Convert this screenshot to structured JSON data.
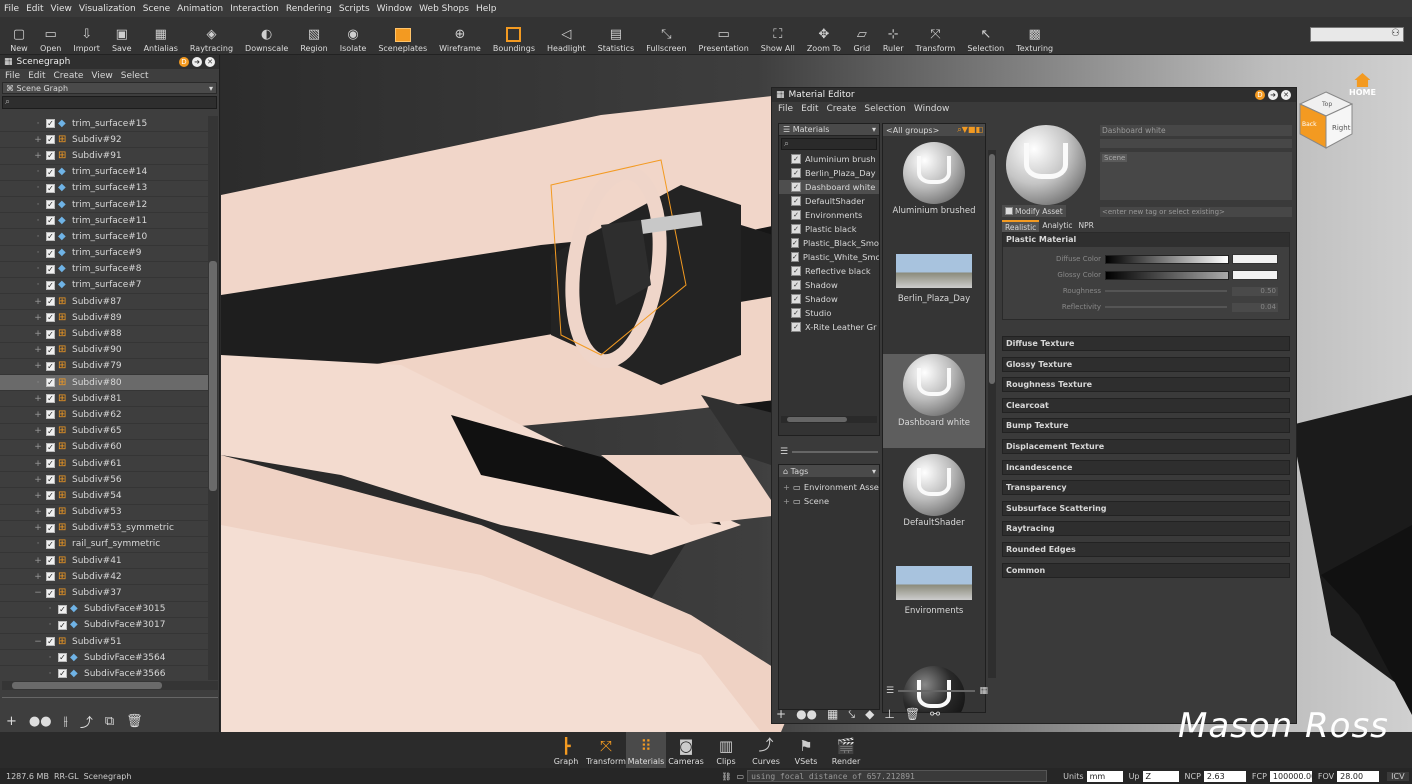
{
  "menubar": [
    "File",
    "Edit",
    "View",
    "Visualization",
    "Scene",
    "Animation",
    "Interaction",
    "Rendering",
    "Scripts",
    "Window",
    "Web Shops",
    "Help"
  ],
  "toolbar": [
    {
      "label": "New",
      "icon": "new-icon"
    },
    {
      "label": "Open",
      "icon": "open-icon"
    },
    {
      "label": "Import",
      "icon": "import-icon"
    },
    {
      "label": "Save",
      "icon": "save-icon"
    },
    {
      "label": "Antialias",
      "icon": "antialias-icon"
    },
    {
      "label": "Raytracing",
      "icon": "raytracing-icon"
    },
    {
      "label": "Downscale",
      "icon": "downscale-icon"
    },
    {
      "label": "Region",
      "icon": "region-icon"
    },
    {
      "label": "Isolate",
      "icon": "isolate-icon"
    },
    {
      "label": "Sceneplates",
      "icon": "sceneplates-icon"
    },
    {
      "label": "Wireframe",
      "icon": "wireframe-icon"
    },
    {
      "label": "Boundings",
      "icon": "boundings-icon"
    },
    {
      "label": "Headlight",
      "icon": "headlight-icon"
    },
    {
      "label": "Statistics",
      "icon": "statistics-icon"
    },
    {
      "label": "Fullscreen",
      "icon": "fullscreen-icon"
    },
    {
      "label": "Presentation",
      "icon": "presentation-icon"
    },
    {
      "label": "Show All",
      "icon": "show-all-icon"
    },
    {
      "label": "Zoom To",
      "icon": "zoom-to-icon"
    },
    {
      "label": "Grid",
      "icon": "grid-icon"
    },
    {
      "label": "Ruler",
      "icon": "ruler-icon"
    },
    {
      "label": "Transform",
      "icon": "transform-icon"
    },
    {
      "label": "Selection",
      "icon": "selection-icon"
    },
    {
      "label": "Texturing",
      "icon": "texturing-icon"
    }
  ],
  "scenegraph": {
    "title": "Scenegraph",
    "menu": [
      "File",
      "Edit",
      "Create",
      "View",
      "Select"
    ],
    "dropdown": "Scene Graph",
    "rows": [
      {
        "label": "trim_surface#15",
        "type": "trim",
        "exp": ""
      },
      {
        "label": "Subdiv#92",
        "type": "sub",
        "exp": "+"
      },
      {
        "label": "Subdiv#91",
        "type": "sub",
        "exp": "+"
      },
      {
        "label": "trim_surface#14",
        "type": "trim",
        "exp": ""
      },
      {
        "label": "trim_surface#13",
        "type": "trim",
        "exp": ""
      },
      {
        "label": "trim_surface#12",
        "type": "trim",
        "exp": ""
      },
      {
        "label": "trim_surface#11",
        "type": "trim",
        "exp": ""
      },
      {
        "label": "trim_surface#10",
        "type": "trim",
        "exp": ""
      },
      {
        "label": "trim_surface#9",
        "type": "trim",
        "exp": ""
      },
      {
        "label": "trim_surface#8",
        "type": "trim",
        "exp": ""
      },
      {
        "label": "trim_surface#7",
        "type": "trim",
        "exp": ""
      },
      {
        "label": "Subdiv#87",
        "type": "sub",
        "exp": "+"
      },
      {
        "label": "Subdiv#89",
        "type": "sub",
        "exp": "+"
      },
      {
        "label": "Subdiv#88",
        "type": "sub",
        "exp": "+"
      },
      {
        "label": "Subdiv#90",
        "type": "sub",
        "exp": "+"
      },
      {
        "label": "Subdiv#79",
        "type": "sub",
        "exp": "+"
      },
      {
        "label": "Subdiv#80",
        "type": "sub",
        "exp": "",
        "selected": true
      },
      {
        "label": "Subdiv#81",
        "type": "sub",
        "exp": "+"
      },
      {
        "label": "Subdiv#62",
        "type": "sub",
        "exp": "+"
      },
      {
        "label": "Subdiv#65",
        "type": "sub",
        "exp": "+"
      },
      {
        "label": "Subdiv#60",
        "type": "sub",
        "exp": "+"
      },
      {
        "label": "Subdiv#61",
        "type": "sub",
        "exp": "+"
      },
      {
        "label": "Subdiv#56",
        "type": "sub",
        "exp": "+"
      },
      {
        "label": "Subdiv#54",
        "type": "sub",
        "exp": "+"
      },
      {
        "label": "Subdiv#53",
        "type": "sub",
        "exp": "+"
      },
      {
        "label": "Subdiv#53_symmetric",
        "type": "sub",
        "exp": "+"
      },
      {
        "label": "rail_surf_symmetric",
        "type": "sub",
        "exp": ""
      },
      {
        "label": "Subdiv#41",
        "type": "sub",
        "exp": "+"
      },
      {
        "label": "Subdiv#42",
        "type": "sub",
        "exp": "+"
      },
      {
        "label": "Subdiv#37",
        "type": "sub",
        "exp": "−"
      },
      {
        "label": "SubdivFace#3015",
        "type": "trim",
        "exp": "",
        "indent": true
      },
      {
        "label": "SubdivFace#3017",
        "type": "trim",
        "exp": "",
        "indent": true
      },
      {
        "label": "Subdiv#51",
        "type": "sub",
        "exp": "−"
      },
      {
        "label": "SubdivFace#3564",
        "type": "trim",
        "exp": "",
        "indent": true
      },
      {
        "label": "SubdivFace#3566",
        "type": "trim",
        "exp": "",
        "indent": true
      }
    ]
  },
  "viewport": {
    "home_label": "HOME",
    "cube_faces": [
      "Top",
      "Back",
      "Right"
    ]
  },
  "material_editor": {
    "title": "Material Editor",
    "menu": [
      "File",
      "Edit",
      "Create",
      "Selection",
      "Window"
    ],
    "list_header": "Materials",
    "group_header": "<All groups>",
    "materials": [
      {
        "label": "Aluminium brush",
        "selected": false
      },
      {
        "label": "Berlin_Plaza_Day",
        "selected": false
      },
      {
        "label": "Dashboard white",
        "selected": true
      },
      {
        "label": "DefaultShader",
        "selected": false
      },
      {
        "label": "Environments",
        "selected": false
      },
      {
        "label": "Plastic black",
        "selected": false
      },
      {
        "label": "Plastic_Black_Smo",
        "selected": false
      },
      {
        "label": "Plastic_White_Smo",
        "selected": false
      },
      {
        "label": "Reflective black",
        "selected": false
      },
      {
        "label": "Shadow",
        "selected": false
      },
      {
        "label": "Shadow",
        "selected": false
      },
      {
        "label": "Studio",
        "selected": false
      },
      {
        "label": "X-Rite Leather Gr",
        "selected": false
      }
    ],
    "tags_header": "Tags",
    "tags": [
      "Environment Asse",
      "Scene"
    ],
    "thumbnails": [
      {
        "label": "Aluminium brushed",
        "kind": "ball"
      },
      {
        "label": "Berlin_Plaza_Day",
        "kind": "sky"
      },
      {
        "label": "Dashboard white",
        "kind": "ball",
        "selected": true
      },
      {
        "label": "DefaultShader",
        "kind": "ball"
      },
      {
        "label": "Environments",
        "kind": "sky"
      },
      {
        "label": "",
        "kind": "dark"
      }
    ],
    "asset_name": "Dashboard white",
    "tag_chip": "Scene",
    "modify_label": "Modify Asset",
    "tag_placeholder": "<enter new tag or select existing>",
    "tabs": [
      "Realistic",
      "Analytic",
      "NPR"
    ],
    "section_title": "Plastic Material",
    "props": {
      "diffuse_label": "Diffuse Color",
      "glossy_label": "Glossy Color",
      "roughness_label": "Roughness",
      "roughness_value": "0.50",
      "reflectivity_label": "Reflectivity",
      "reflectivity_value": "0.04"
    },
    "sections": [
      "Diffuse Texture",
      "Glossy Texture",
      "Roughness Texture",
      "Clearcoat",
      "Bump Texture",
      "Displacement Texture",
      "Incandescence",
      "Transparency",
      "Subsurface Scattering",
      "Raytracing",
      "Rounded Edges",
      "Common"
    ]
  },
  "bottom_tabs": [
    {
      "label": "Graph",
      "icon": "graph-icon"
    },
    {
      "label": "Transform",
      "icon": "transform-icon"
    },
    {
      "label": "Materials",
      "icon": "materials-icon",
      "active": true
    },
    {
      "label": "Cameras",
      "icon": "cameras-icon"
    },
    {
      "label": "Clips",
      "icon": "clips-icon"
    },
    {
      "label": "Curves",
      "icon": "curves-icon"
    },
    {
      "label": "VSets",
      "icon": "vsets-icon"
    },
    {
      "label": "Render",
      "icon": "render-icon"
    }
  ],
  "signature": "Mason Ross",
  "status": {
    "memory": "1287.6 MB",
    "renderer": "RR-GL",
    "module": "Scenegraph",
    "console": "using focal distance of 657.212891",
    "units_label": "Units",
    "units_value": "mm",
    "up_label": "Up",
    "up_value": "Z",
    "ncp_label": "NCP",
    "ncp_value": "2.63",
    "fcp_label": "FCP",
    "fcp_value": "100000.00",
    "fov_label": "FOV",
    "fov_value": "28.00",
    "icv": "ICV"
  },
  "colors": {
    "accent": "#f39a21",
    "panel": "#3e3e3e",
    "viewport_car": "#f2d9cc"
  }
}
